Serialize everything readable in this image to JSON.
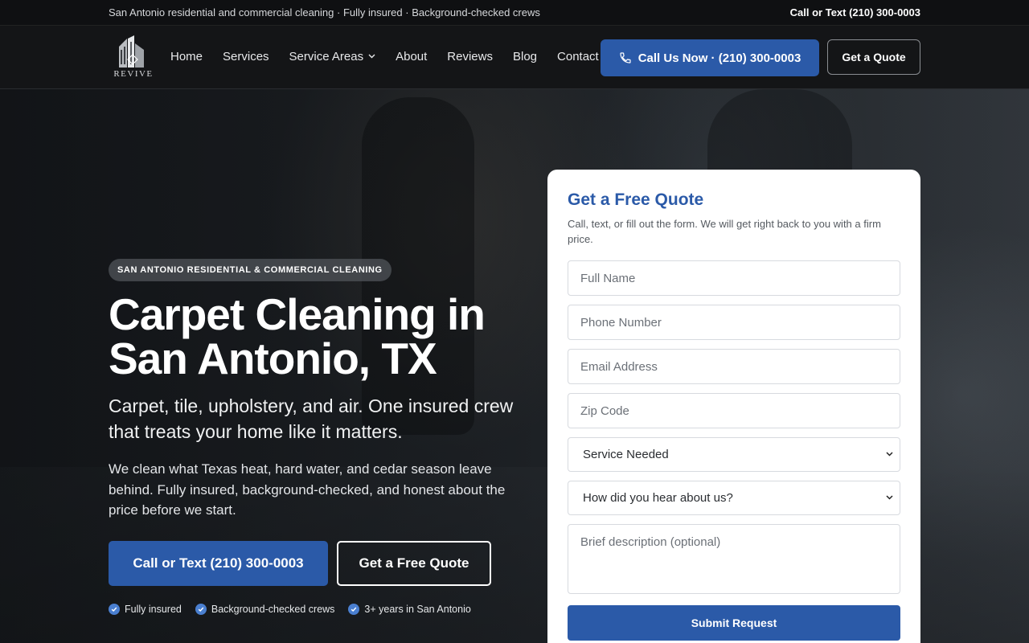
{
  "topbar": {
    "tagline": "San Antonio residential and commercial cleaning · Fully insured · Background-checked crews",
    "phone": "Call or Text (210) 300-0003"
  },
  "nav": {
    "logo_alt": "REVIVE",
    "links": [
      {
        "label": "Home"
      },
      {
        "label": "Services"
      },
      {
        "label": "Service Areas",
        "dropdown": true
      },
      {
        "label": "About"
      },
      {
        "label": "Reviews"
      },
      {
        "label": "Blog"
      },
      {
        "label": "Contact"
      }
    ],
    "call_button": "Call Us Now · (210) 300-0003",
    "quote_button": "Get a Quote"
  },
  "hero": {
    "badge": "SAN ANTONIO RESIDENTIAL & COMMERCIAL CLEANING",
    "title": "Carpet Cleaning in San Antonio, TX",
    "subtitle": "Carpet, tile, upholstery, and air. One insured crew that treats your home like it matters.",
    "paragraph": "We clean what Texas heat, hard water, and cedar season leave behind. Fully insured, background-checked, and honest about the price before we start.",
    "call_button": "Call or Text (210) 300-0003",
    "quote_button": "Get a Free Quote",
    "trust": [
      "Fully insured",
      "Background-checked crews",
      "3+ years in San Antonio"
    ]
  },
  "form": {
    "title": "Get a Free Quote",
    "subtitle": "Call, text, or fill out the form. We will get right back to you with a firm price.",
    "full_name_placeholder": "Full Name",
    "phone_placeholder": "Phone Number",
    "email_placeholder": "Email Address",
    "zip_placeholder": "Zip Code",
    "service_select": "Service Needed",
    "source_select": "How did you hear about us?",
    "description_placeholder": "Brief description (optional)",
    "submit": "Submit Request"
  },
  "colors": {
    "accent": "#2b5aa8",
    "topbar_bg": "#0f1012",
    "nav_bg": "#141517"
  }
}
